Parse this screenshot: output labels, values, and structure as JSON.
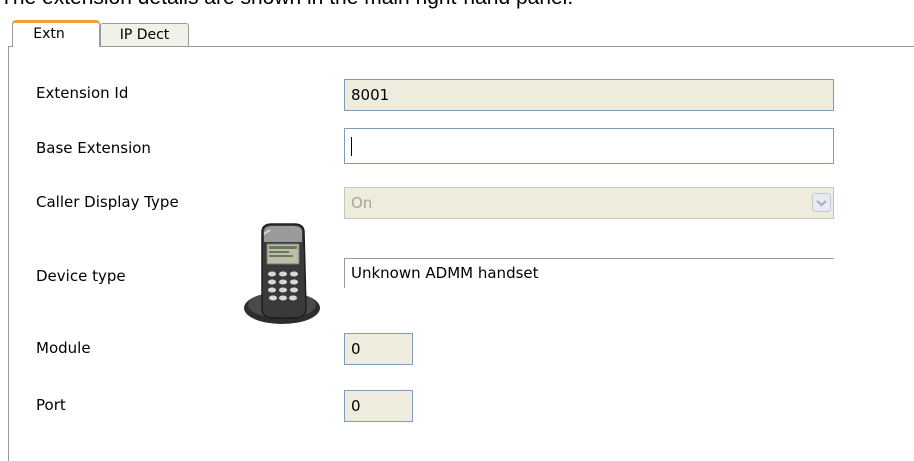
{
  "caption": "The extension details are shown in the main right-hand panel.",
  "tabs": [
    {
      "label": "Extn",
      "active": true
    },
    {
      "label": "IP Dect",
      "active": false
    }
  ],
  "form": {
    "extension_id": {
      "label": "Extension Id",
      "value": "8001"
    },
    "base_extension": {
      "label": "Base Extension",
      "value": ""
    },
    "caller_display_type": {
      "label": "Caller Display Type",
      "value": "On"
    },
    "device_type": {
      "label": "Device type",
      "value": "Unknown ADMM handset",
      "icon": "dect-handset-icon"
    },
    "module": {
      "label": "Module",
      "value": "0"
    },
    "port": {
      "label": "Port",
      "value": "0"
    }
  },
  "colors": {
    "active_tab_accent": "#f0a030",
    "readonly_field_bg": "#efebdd",
    "field_border": "#7f9db9"
  }
}
